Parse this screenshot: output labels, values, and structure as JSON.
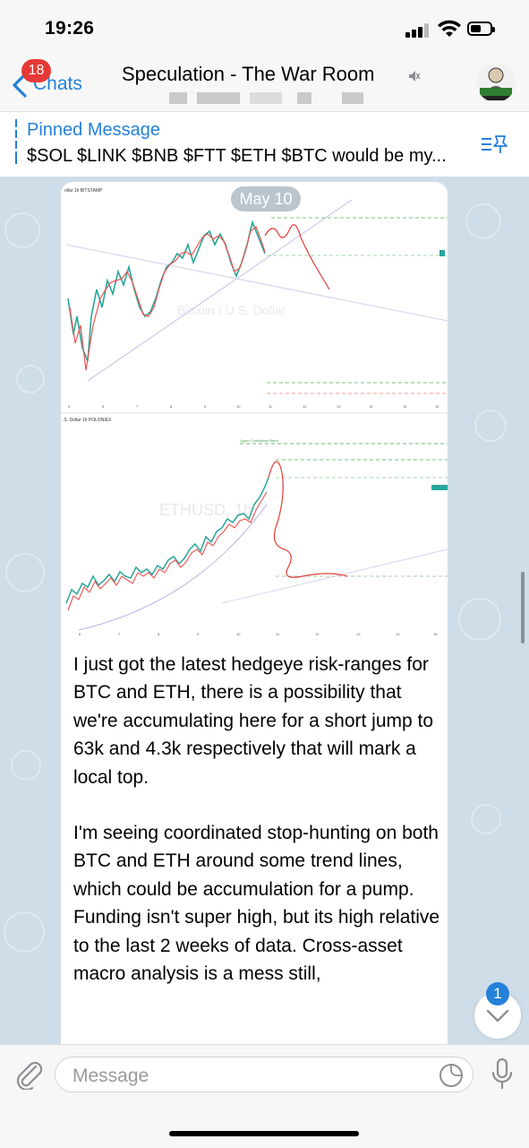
{
  "status_bar": {
    "time": "19:26"
  },
  "header": {
    "back_label": "Chats",
    "unread_count": "18",
    "title": "Speculation - The War Room"
  },
  "pinned": {
    "title": "Pinned Message",
    "text": "$SOL $LINK $BNB $FTT $ETH $BTC  would be my..."
  },
  "message": {
    "date_label": "May 10",
    "paragraphs": [
      "I just got the latest hedgeye risk-ranges for BTC and ETH, there is a possibility that we're accumulating here for a short jump to 63k and 4.3k respectively that will mark a local top.",
      "I'm seeing coordinated stop-hunting on both BTC and ETH around some trend lines, which could be accumulation for a pump. Funding isn't super high, but its high relative to the last 2 weeks of data. Cross-asset macro analysis is a mess still,"
    ]
  },
  "charts": {
    "top_header": "ollar  1h  BITSTAMP",
    "top_watermark": "Bitcoin / U.S. Dollar",
    "bottom_header": ".S. Dollar  1h  POLONIEX",
    "bottom_watermark": "ETHUSD, 1h",
    "bottom_label": "Upper Confidence Band",
    "top_ticks": [
      "5",
      "6",
      "7",
      "8",
      "9",
      "10",
      "11",
      "12",
      "13",
      "14",
      "15",
      "16"
    ],
    "bottom_ticks": [
      "6",
      "7",
      "8",
      "9",
      "10",
      "11",
      "12",
      "13",
      "14",
      "15"
    ]
  },
  "scroll": {
    "unread": "1"
  },
  "input": {
    "placeholder": "Message"
  },
  "icons": [
    "back-chevron-icon",
    "mute-icon",
    "pinned-list-icon",
    "attach-icon",
    "sticker-icon",
    "mic-icon",
    "chevron-down-icon"
  ],
  "colors": {
    "accent": "#2480d8",
    "badge": "#e53935",
    "chat_bg": "#cfdde8"
  }
}
